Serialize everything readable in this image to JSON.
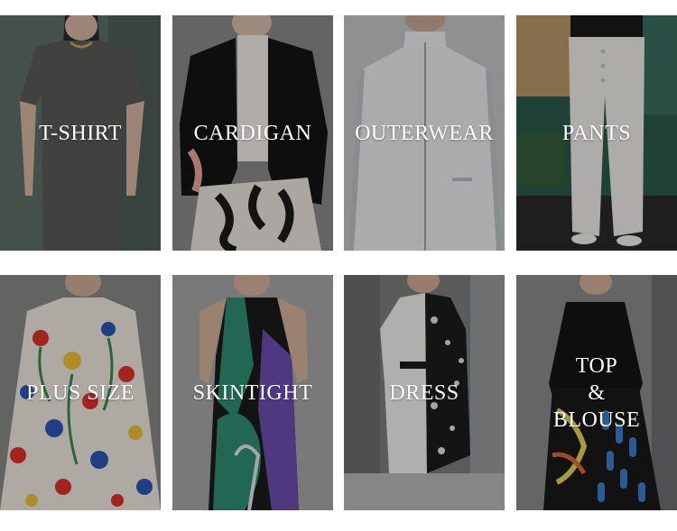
{
  "categories": [
    {
      "id": "t-shirt",
      "label": "T-SHIRT"
    },
    {
      "id": "cardigan",
      "label": "CARDIGAN"
    },
    {
      "id": "outerwear",
      "label": "OUTERWEAR"
    },
    {
      "id": "pants",
      "label": "PANTS"
    },
    {
      "id": "plus-size",
      "label": "PLUS SIZE"
    },
    {
      "id": "skintight",
      "label": "SKINTIGHT"
    },
    {
      "id": "dress",
      "label": "DRESS"
    },
    {
      "id": "top-blouse",
      "label": "TOP\n&\nBLOUSE"
    }
  ]
}
